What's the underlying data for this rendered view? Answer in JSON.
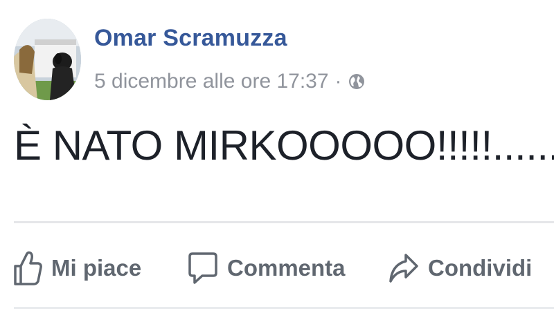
{
  "post": {
    "author_name": "Omar Scramuzza",
    "timestamp": "5 dicembre alle ore 17:37",
    "separator": "·",
    "privacy_icon": "globe-icon",
    "message": "È NATO MIRKOOOOO!!!!!......"
  },
  "actions": {
    "like": {
      "label": "Mi piace",
      "icon": "thumbs-up-icon"
    },
    "comment": {
      "label": "Commenta",
      "icon": "speech-bubble-icon"
    },
    "share": {
      "label": "Condividi",
      "icon": "share-arrow-icon"
    }
  },
  "colors": {
    "author_link": "#365899",
    "meta_text": "#90949c",
    "message_text": "#1d2129",
    "action_text": "#606770",
    "divider": "#e5e6e9"
  }
}
